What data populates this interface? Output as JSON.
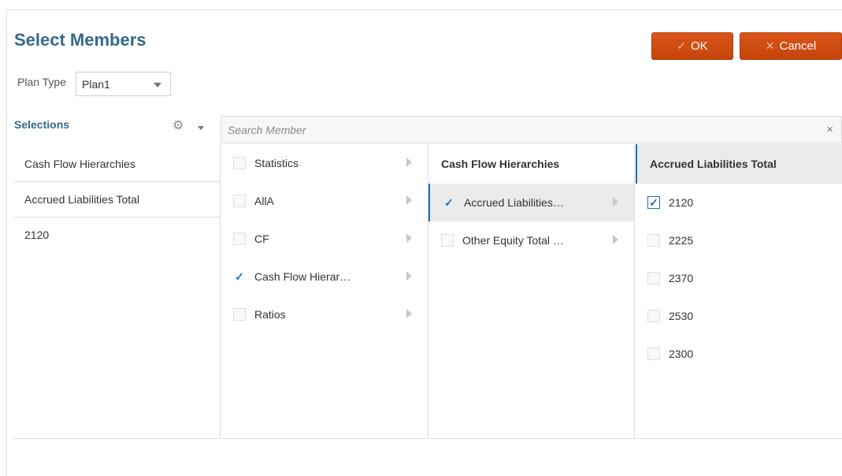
{
  "dialog": {
    "title": "Select Members",
    "ok_label": "OK",
    "cancel_label": "Cancel"
  },
  "plan_type": {
    "label": "Plan Type",
    "value": "Plan1"
  },
  "selections": {
    "header": "Selections",
    "items": [
      "Cash Flow Hierarchies",
      "Accrued Liabilities Total",
      "2120"
    ]
  },
  "search": {
    "placeholder": "Search Member",
    "clear": "×"
  },
  "column1": {
    "items": [
      {
        "label": "Statistics",
        "checked": false
      },
      {
        "label": "AllA",
        "checked": false
      },
      {
        "label": "CF",
        "checked": false
      },
      {
        "label": "Cash Flow Hierar…",
        "checked": true
      },
      {
        "label": "Ratios",
        "checked": false
      }
    ]
  },
  "column2": {
    "header": "Cash Flow Hierarchies",
    "items": [
      {
        "label": "Accrued Liabilities…",
        "checked": true
      },
      {
        "label": "Other Equity Total …",
        "checked": false
      }
    ]
  },
  "column3": {
    "header": "Accrued Liabilities Total",
    "items": [
      {
        "label": "2120",
        "checked": true
      },
      {
        "label": "2225",
        "checked": false
      },
      {
        "label": "2370",
        "checked": false
      },
      {
        "label": "2530",
        "checked": false
      },
      {
        "label": "2300",
        "checked": false
      }
    ]
  },
  "colors": {
    "title": "#336a8c",
    "button": "#cc4a0b",
    "accent": "#1f6db5"
  }
}
